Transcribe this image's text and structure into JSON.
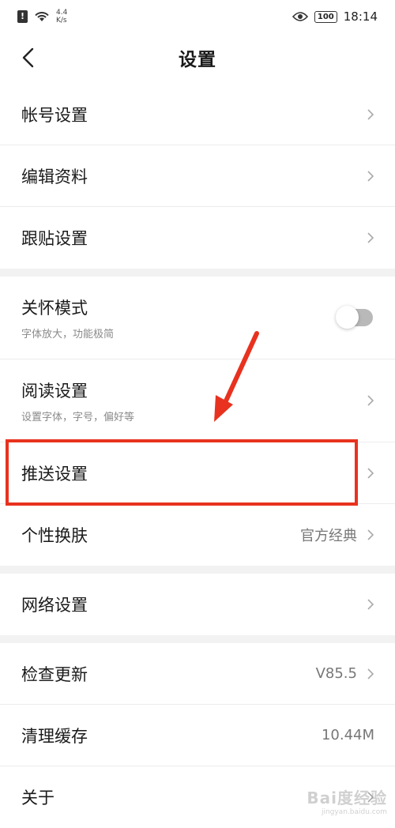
{
  "status_bar": {
    "sim_icon": "sim-alert-icon",
    "wifi_icon": "wifi-icon",
    "net_speed_value": "4.4",
    "net_speed_unit": "K/s",
    "eye_icon": "eye-icon",
    "battery": "100",
    "time": "18:14"
  },
  "header": {
    "back_icon": "back-chevron-icon",
    "title": "设置"
  },
  "groups": [
    {
      "items": [
        {
          "label": "帐号设置",
          "icon": "chevron-right-icon"
        },
        {
          "label": "编辑资料",
          "icon": "chevron-right-icon"
        },
        {
          "label": "跟贴设置",
          "icon": "chevron-right-icon"
        }
      ]
    },
    {
      "items": [
        {
          "label": "关怀模式",
          "subtitle": "字体放大，功能极简",
          "toggle": "off"
        },
        {
          "label": "阅读设置",
          "subtitle": "设置字体，字号，偏好等",
          "icon": "chevron-right-icon"
        },
        {
          "label": "推送设置",
          "icon": "chevron-right-icon"
        },
        {
          "label": "个性换肤",
          "value": "官方经典",
          "icon": "chevron-right-icon"
        }
      ]
    },
    {
      "items": [
        {
          "label": "网络设置",
          "icon": "chevron-right-icon"
        }
      ]
    },
    {
      "items": [
        {
          "label": "检查更新",
          "value": "V85.5",
          "icon": "chevron-right-icon"
        },
        {
          "label": "清理缓存",
          "value": "10.44M"
        },
        {
          "label": "关于",
          "icon": "chevron-right-icon"
        }
      ]
    }
  ],
  "annotation": {
    "color": "#e8321f",
    "highlight_target": "推送设置"
  },
  "watermark": {
    "main": "Bai度经验",
    "sub": "jingyan.baidu.com"
  }
}
